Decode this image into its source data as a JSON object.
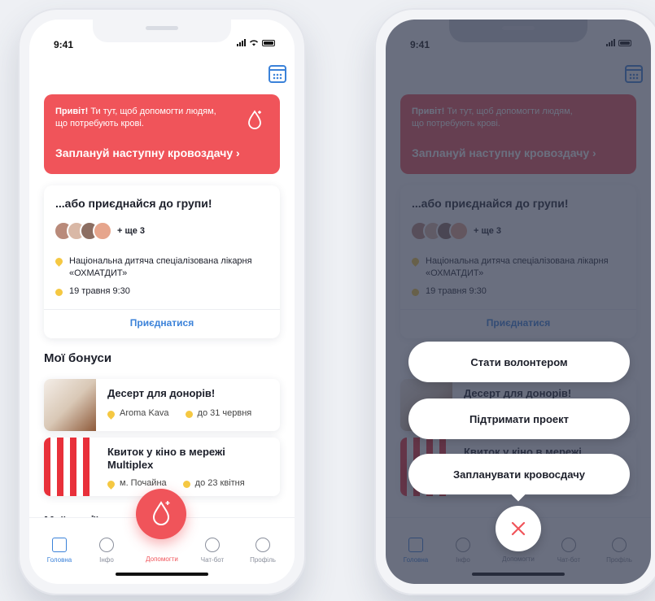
{
  "status": {
    "time": "9:41"
  },
  "hero": {
    "greeting_bold": "Привіт!",
    "greeting_rest": " Ти тут, щоб допомогти людям, що потребують крові.",
    "cta": "Заплануй наступну кровоздачу",
    "cta_chevron": "›"
  },
  "group_card": {
    "title": "...або приєднайся до групи!",
    "more": "+ ще 3",
    "location": "Національна дитяча спеціалізована лікарня «ОХМАТДИТ»",
    "datetime": "19 травня 9:30",
    "join": "Приєднатися"
  },
  "bonuses": {
    "title": "Мої бонуси",
    "items": [
      {
        "title": "Десерт для донорів!",
        "place": "Aroma Kava",
        "until": "до 31 червня"
      },
      {
        "title": "Квиток у кіно в мережі Multiplex",
        "place": "м. Почайна",
        "until": "до 23 квітня"
      }
    ]
  },
  "events": {
    "title": "Мої події"
  },
  "tabs": [
    {
      "label": "Головна"
    },
    {
      "label": "Інфо"
    },
    {
      "label": "Допомогти"
    },
    {
      "label": "Чат-бот"
    },
    {
      "label": "Профіль"
    }
  ],
  "actions": {
    "volunteer": "Стати волонтером",
    "support": "Підтримати проект",
    "schedule": "Запланувати кровосдачу"
  },
  "colors": {
    "accent_red": "#f0545a",
    "accent_blue": "#3b82d9",
    "overlay": "#30384e"
  }
}
